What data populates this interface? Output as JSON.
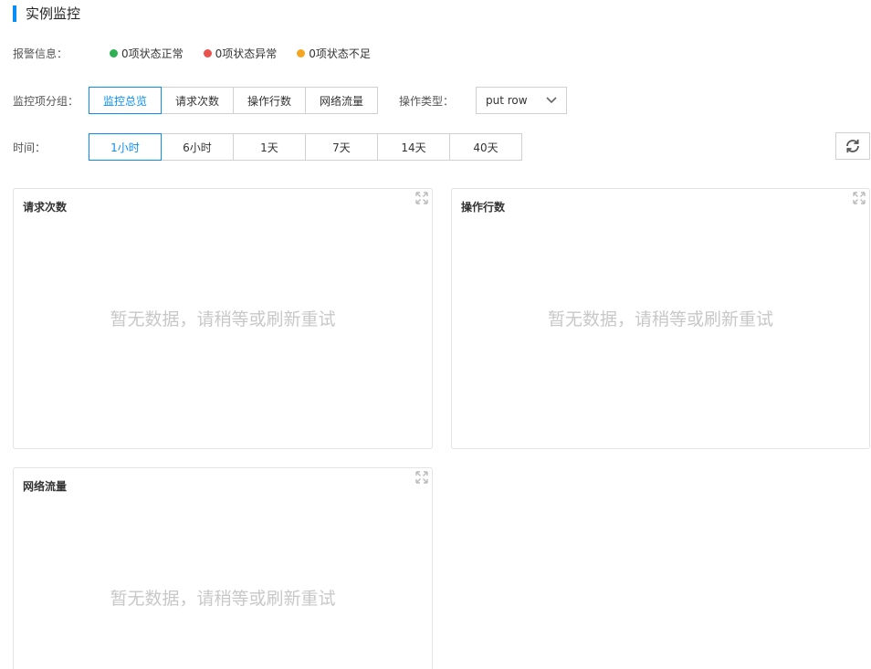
{
  "page_title": "实例监控",
  "alerts": {
    "label": "报警信息：",
    "items": [
      {
        "text": "0项状态正常",
        "color": "#2fb153"
      },
      {
        "text": "0项状态异常",
        "color": "#e9524d"
      },
      {
        "text": "0项状态不足",
        "color": "#f4a623"
      }
    ]
  },
  "group": {
    "label": "监控项分组：",
    "options": [
      "监控总览",
      "请求次数",
      "操作行数",
      "网络流量"
    ],
    "selected": "监控总览"
  },
  "op_type": {
    "label": "操作类型：",
    "value": "put row",
    "icon": "chevron-down-icon"
  },
  "time": {
    "label": "时间：",
    "options": [
      "1小时",
      "6小时",
      "1天",
      "7天",
      "14天",
      "40天"
    ],
    "selected": "1小时"
  },
  "refresh_icon": "refresh-icon",
  "panels": [
    {
      "title": "请求次数",
      "empty_text": "暂无数据，请稍等或刷新重试"
    },
    {
      "title": "操作行数",
      "empty_text": "暂无数据，请稍等或刷新重试"
    },
    {
      "title": "网络流量",
      "empty_text": "暂无数据，请稍等或刷新重试"
    }
  ],
  "colors": {
    "accent": "#0a8ef5"
  }
}
